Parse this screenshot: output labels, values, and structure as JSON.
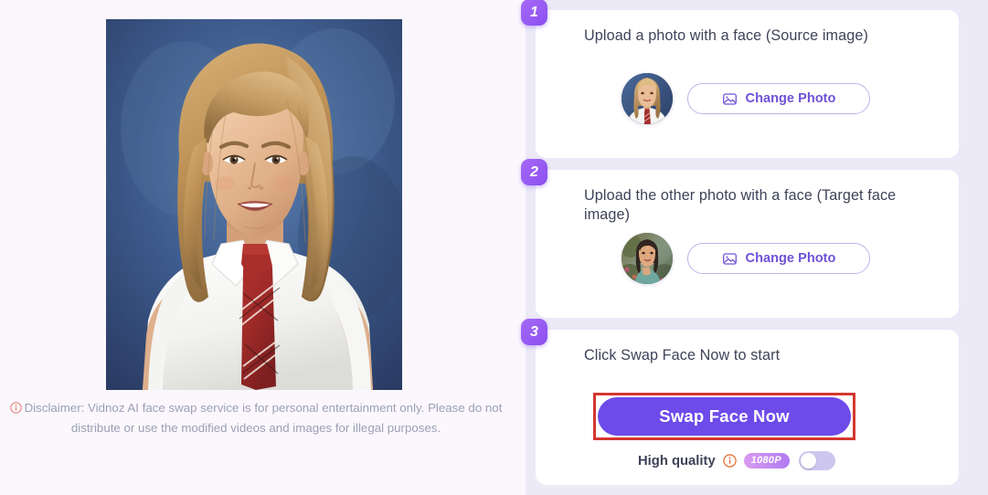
{
  "theme": {
    "page_bg": "#fbf7fc",
    "panel_bg": "#eceaf7",
    "card_bg": "#ffffff",
    "accent_purple": "#6c4bea",
    "badge_gradient_from": "#a669f5",
    "badge_gradient_to": "#8b4ff0",
    "annotation_red": "#d3372f",
    "text_dark": "#3f4359",
    "text_muted": "#9ba0b5"
  },
  "preview": {
    "name": "source-photo-preview",
    "description": "Portrait photo of a smiling young woman with long blonde hair, wearing a white short-sleeve school shirt and a red plaid necktie, against a mottled blue studio backdrop"
  },
  "disclaimer": {
    "icon": "info-circle-icon",
    "text": "Disclaimer: Vidnoz AI face swap service is for personal entertainment only. Please do not distribute or use the modified videos and images for illegal purposes."
  },
  "steps": [
    {
      "number": "1",
      "title": "Upload a photo with a face (Source image)",
      "thumbnail_alt": "Blonde woman in white shirt with red tie",
      "button_label": "Change Photo",
      "button_icon": "image-icon"
    },
    {
      "number": "2",
      "title": "Upload the other photo with a face (Target face image)",
      "thumbnail_alt": "Dark-haired woman in teal top among flowers",
      "button_label": "Change Photo",
      "button_icon": "image-icon"
    },
    {
      "number": "3",
      "title": "Click Swap Face Now to start",
      "swap_button_label": "Swap Face Now",
      "quality_label": "High quality",
      "quality_info_icon": "info-circle-icon",
      "resolution_badge": "1080P",
      "toggle_state": "off"
    }
  ]
}
